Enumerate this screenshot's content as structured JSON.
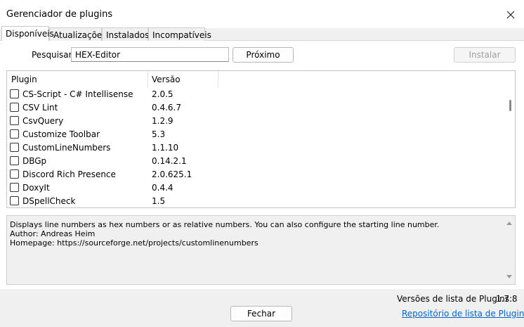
{
  "window": {
    "title": "Gerenciador de plugins"
  },
  "tabs": [
    {
      "label": "Disponíveis"
    },
    {
      "label": "Atualizações"
    },
    {
      "label": "Instalados"
    },
    {
      "label": "Incompatíveis"
    }
  ],
  "search": {
    "label": "Pesquisar:",
    "value": "HEX-Editor"
  },
  "buttons": {
    "next": "Próximo",
    "install": "Instalar",
    "close": "Fechar"
  },
  "list": {
    "columns": [
      "Plugin",
      "Versão"
    ],
    "rows": [
      {
        "name": "CS-Script - C# Intellisense",
        "version": "2.0.5",
        "checked": false
      },
      {
        "name": "CSV Lint",
        "version": "0.4.6.7",
        "checked": false
      },
      {
        "name": "CsvQuery",
        "version": "1.2.9",
        "checked": false
      },
      {
        "name": "Customize Toolbar",
        "version": "5.3",
        "checked": false
      },
      {
        "name": "CustomLineNumbers",
        "version": "1.1.10",
        "checked": false
      },
      {
        "name": "DBGp",
        "version": "0.14.2.1",
        "checked": false
      },
      {
        "name": "Discord Rich Presence",
        "version": "2.0.625.1",
        "checked": false
      },
      {
        "name": "DoxyIt",
        "version": "0.4.4",
        "checked": false
      },
      {
        "name": "DSpellCheck",
        "version": "1.5",
        "checked": false
      }
    ]
  },
  "description": {
    "line1": "Displays line numbers as hex numbers or as relative numbers. You can also configure the starting line number.",
    "line2": "Author: Andreas Heim",
    "line3": "Homepage: https://sourceforge.net/projects/customlinenumbers"
  },
  "footer": {
    "list_version_label": "Versões de lista de Plugins:",
    "list_version_value": "1.7.8",
    "repo_link": "Repositório de lista de Plugins"
  }
}
